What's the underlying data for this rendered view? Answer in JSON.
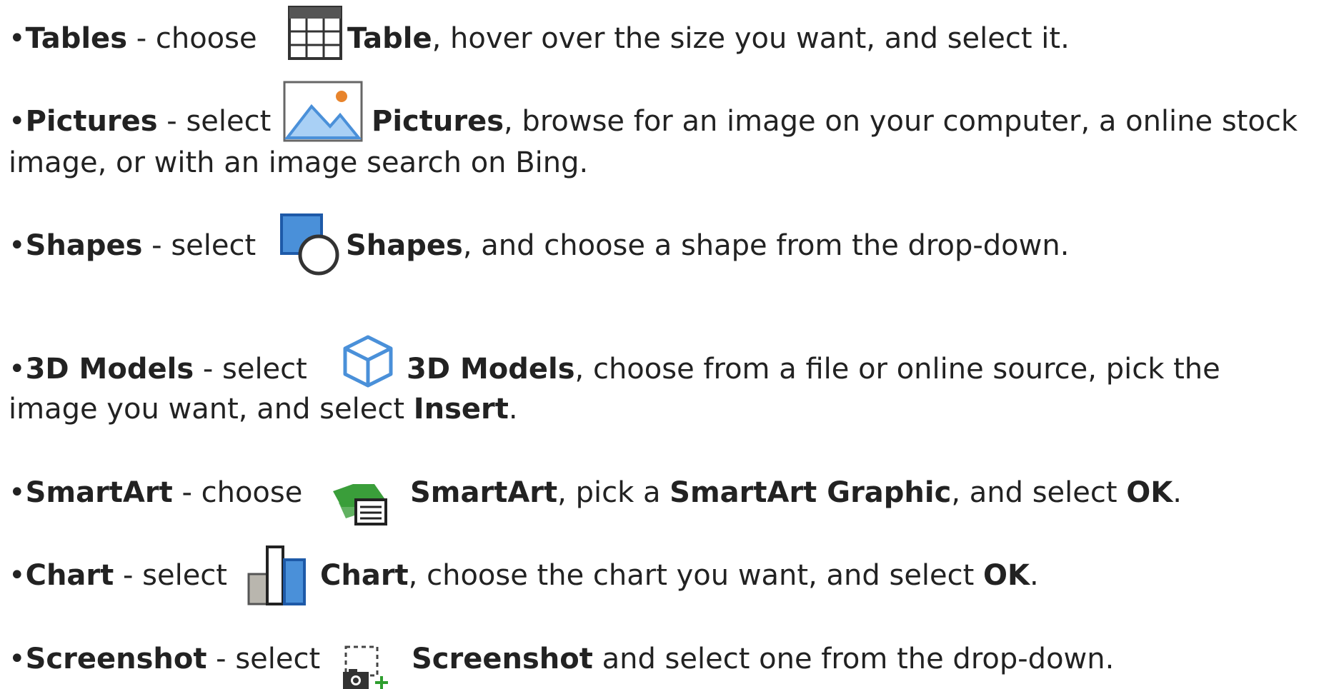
{
  "items": {
    "tables": {
      "bullet": "•",
      "term": "Tables",
      "verb": " - choose ",
      "icon": "table-icon",
      "label": "Table",
      "rest": ", hover over the size you want, and select it."
    },
    "pictures": {
      "bullet": "•",
      "term": "Pictures",
      "verb": " - select ",
      "icon": "picture-icon",
      "label": "Pictures",
      "rest": ", browse for an image on your computer, a online stock",
      "rest2": "image, or with an image search on Bing."
    },
    "shapes": {
      "bullet": "•",
      "term": "Shapes",
      "verb": " - select ",
      "icon": "shapes-icon",
      "label": "Shapes",
      "rest": ", and choose a shape from the drop-down."
    },
    "models": {
      "bullet": "•",
      "term": "3D Models",
      "verb": " - select ",
      "icon": "3d-models-icon",
      "label": "3D Models",
      "rest": ", choose from a file or online source, pick the",
      "rest2": "image you want, and select ",
      "strong2": "Insert",
      "end2": "."
    },
    "smartart": {
      "bullet": "•",
      "term": "SmartArt",
      "verb": " - choose ",
      "icon": "smartart-icon",
      "label": "SmartArt",
      "rest": ", pick a ",
      "strong": "SmartArt Graphic",
      "rest_b": ", and select ",
      "strong_b": "OK",
      "end": "."
    },
    "chart": {
      "bullet": "•",
      "term": "Chart",
      "verb": " - select ",
      "icon": "chart-icon",
      "label": "Chart",
      "rest": ", choose the chart you want, and select ",
      "strong": "OK",
      "end": "."
    },
    "screenshot": {
      "bullet": "•",
      "term": "Screenshot",
      "verb": " - select ",
      "icon": "screenshot-icon",
      "label": "Screenshot",
      "rest": " and select one from the drop-down."
    }
  },
  "colors": {
    "text": "#222222",
    "icon_blue": "#4a90d9",
    "icon_light_blue": "#a9d0f5",
    "icon_green": "#3a9e3a",
    "icon_orange": "#e8842c",
    "icon_gray": "#b9b6ae"
  }
}
